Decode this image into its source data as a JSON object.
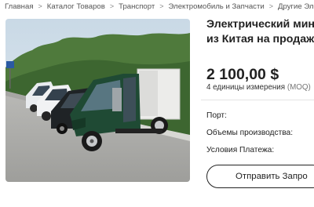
{
  "breadcrumb": {
    "items": [
      "Главная",
      "Каталог Товаров",
      "Транспорт",
      "Электромобиль и Запчасти",
      "Другие Электромобили"
    ],
    "separator": ">"
  },
  "product": {
    "title_line1": "Электрический мин",
    "title_line2": "из Китая на продаж",
    "price": "2 100,00 $",
    "moq_value": "4 единицы измерения",
    "moq_label": "(MOQ)"
  },
  "details": {
    "port_label": "Порт:",
    "capacity_label": "Объемы производства:",
    "payment_label": "Условия Платежа:"
  },
  "cta": {
    "send_inquiry_label": "Отправить Запро"
  },
  "colors": {
    "vehicle_green": "#1f4a34",
    "text": "#222222"
  }
}
